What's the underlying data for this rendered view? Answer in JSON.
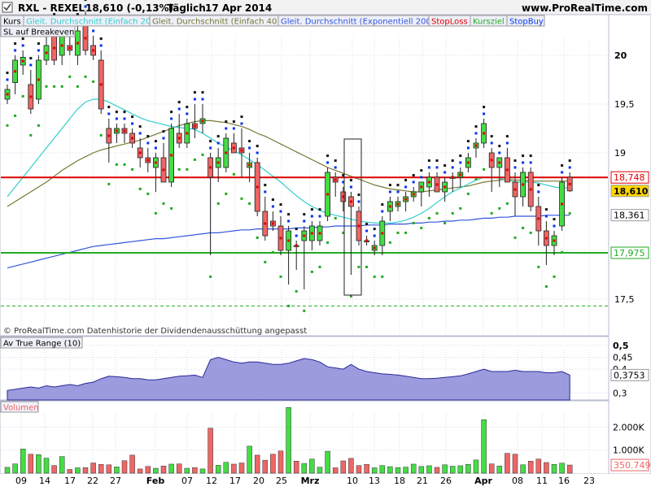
{
  "header": {
    "symbol": "RXL - REXEL",
    "quote": "18,610 (-0,13%)",
    "period": "Täglich",
    "date": "17 Apr 2014",
    "site": "www.ProRealTime.com"
  },
  "legend": {
    "kurs": "Kurs",
    "sma20": "Gleit. Durchschnitt (Einfach 20)",
    "sma40": "Gleit. Durchschnitt (Einfach 40)",
    "ema200": "Gleit. Durchschnitt (Exponentiell 200)",
    "stoploss": "StopLoss",
    "kursziel": "Kursziel",
    "stopbuy": "StopBuy",
    "breakeven": "SL auf Breakeven"
  },
  "footer_note": "© ProRealTime.com  Datenhistorie der Dividendenausschüttung angepasst",
  "atr_label": "Av True Range (10)",
  "volume_label": "Volumen",
  "colors": {
    "up": "#44dd44",
    "down": "#ee6666",
    "sma20": "#33cccc",
    "sma40": "#777733",
    "ema200": "#3355dd",
    "stoploss": "#dd0000",
    "kursziel": "#22aa22",
    "stopbuy": "#0033ee",
    "atr_fill": "#8a8ad8"
  },
  "chart_data": [
    {
      "type": "candlestick",
      "name": "Kurs",
      "y_ticks": [
        "20",
        "19,5",
        "19",
        "18",
        "17,5"
      ],
      "ylim": [
        17.3,
        20.5
      ],
      "x_ticks": [
        "09",
        "14",
        "17",
        "22",
        "27",
        "Feb",
        "07",
        "12",
        "17",
        "20",
        "25",
        "Mrz",
        "10",
        "13",
        "18",
        "21",
        "26",
        "Apr",
        "08",
        "11",
        "16",
        "23"
      ],
      "candles": [
        {
          "o": 19.55,
          "h": 19.7,
          "l": 19.5,
          "c": 19.65
        },
        {
          "o": 19.72,
          "h": 20.0,
          "l": 19.6,
          "c": 19.95
        },
        {
          "o": 19.9,
          "h": 20.05,
          "l": 19.8,
          "c": 19.98
        },
        {
          "o": 19.7,
          "h": 19.85,
          "l": 19.4,
          "c": 19.45
        },
        {
          "o": 19.55,
          "h": 20.0,
          "l": 19.5,
          "c": 19.95
        },
        {
          "o": 19.95,
          "h": 20.25,
          "l": 19.9,
          "c": 20.1
        },
        {
          "o": 20.2,
          "h": 20.3,
          "l": 19.9,
          "c": 19.95
        },
        {
          "o": 20.0,
          "h": 20.25,
          "l": 19.9,
          "c": 20.2
        },
        {
          "o": 20.1,
          "h": 20.25,
          "l": 20.0,
          "c": 20.05
        },
        {
          "o": 20.0,
          "h": 20.3,
          "l": 19.9,
          "c": 20.25
        },
        {
          "o": 20.3,
          "h": 20.45,
          "l": 20.0,
          "c": 20.05
        },
        {
          "o": 20.1,
          "h": 20.2,
          "l": 19.95,
          "c": 20.0
        },
        {
          "o": 19.95,
          "h": 20.05,
          "l": 19.4,
          "c": 19.45
        },
        {
          "o": 19.25,
          "h": 19.35,
          "l": 18.9,
          "c": 19.1
        },
        {
          "o": 19.2,
          "h": 19.3,
          "l": 19.1,
          "c": 19.25
        },
        {
          "o": 19.25,
          "h": 19.3,
          "l": 19.1,
          "c": 19.2
        },
        {
          "o": 19.2,
          "h": 19.25,
          "l": 19.05,
          "c": 19.1
        },
        {
          "o": 19.05,
          "h": 19.15,
          "l": 18.85,
          "c": 18.95
        },
        {
          "o": 18.95,
          "h": 19.05,
          "l": 18.8,
          "c": 18.9
        },
        {
          "o": 18.85,
          "h": 19.0,
          "l": 18.6,
          "c": 18.95
        },
        {
          "o": 18.95,
          "h": 19.1,
          "l": 18.7,
          "c": 18.7
        },
        {
          "o": 18.7,
          "h": 19.3,
          "l": 18.65,
          "c": 19.25
        },
        {
          "o": 19.2,
          "h": 19.4,
          "l": 19.05,
          "c": 19.1
        },
        {
          "o": 19.1,
          "h": 19.35,
          "l": 19.05,
          "c": 19.3
        },
        {
          "o": 19.3,
          "h": 19.5,
          "l": 19.15,
          "c": 19.25
        },
        {
          "o": 19.3,
          "h": 19.5,
          "l": 19.2,
          "c": 19.35
        },
        {
          "o": 18.95,
          "h": 19.0,
          "l": 17.95,
          "c": 18.75
        },
        {
          "o": 18.85,
          "h": 19.05,
          "l": 18.7,
          "c": 18.95
        },
        {
          "o": 18.85,
          "h": 19.2,
          "l": 18.8,
          "c": 19.15
        },
        {
          "o": 19.1,
          "h": 19.2,
          "l": 19.0,
          "c": 19.0
        },
        {
          "o": 19.05,
          "h": 19.25,
          "l": 18.75,
          "c": 19.0
        },
        {
          "o": 18.85,
          "h": 19.0,
          "l": 18.7,
          "c": 18.9
        },
        {
          "o": 18.9,
          "h": 18.95,
          "l": 18.35,
          "c": 18.4
        },
        {
          "o": 18.4,
          "h": 18.55,
          "l": 18.1,
          "c": 18.15
        },
        {
          "o": 18.3,
          "h": 18.4,
          "l": 18.2,
          "c": 18.25
        },
        {
          "o": 18.25,
          "h": 18.35,
          "l": 17.95,
          "c": 18.0
        },
        {
          "o": 18.0,
          "h": 18.25,
          "l": 17.65,
          "c": 18.2
        },
        {
          "o": 18.05,
          "h": 18.1,
          "l": 17.8,
          "c": 18.05
        },
        {
          "o": 18.1,
          "h": 18.25,
          "l": 17.6,
          "c": 18.2
        },
        {
          "o": 18.1,
          "h": 18.3,
          "l": 18.0,
          "c": 18.25
        },
        {
          "o": 18.1,
          "h": 18.3,
          "l": 18.05,
          "c": 18.25
        },
        {
          "o": 18.35,
          "h": 18.85,
          "l": 18.3,
          "c": 18.8
        },
        {
          "o": 18.75,
          "h": 18.8,
          "l": 18.55,
          "c": 18.7
        },
        {
          "o": 18.6,
          "h": 18.65,
          "l": 18.4,
          "c": 18.5
        },
        {
          "o": 18.55,
          "h": 18.6,
          "l": 17.75,
          "c": 18.45
        },
        {
          "o": 18.4,
          "h": 18.45,
          "l": 18.05,
          "c": 18.1
        },
        {
          "o": 18.1,
          "h": 18.15,
          "l": 18.05,
          "c": 18.1
        },
        {
          "o": 18.0,
          "h": 18.1,
          "l": 17.95,
          "c": 18.05
        },
        {
          "o": 18.05,
          "h": 18.35,
          "l": 17.95,
          "c": 18.3
        },
        {
          "o": 18.4,
          "h": 18.55,
          "l": 18.3,
          "c": 18.5
        },
        {
          "o": 18.45,
          "h": 18.55,
          "l": 18.4,
          "c": 18.5
        },
        {
          "o": 18.5,
          "h": 18.6,
          "l": 18.4,
          "c": 18.55
        },
        {
          "o": 18.55,
          "h": 18.65,
          "l": 18.5,
          "c": 18.6
        },
        {
          "o": 18.6,
          "h": 18.7,
          "l": 18.45,
          "c": 18.7
        },
        {
          "o": 18.65,
          "h": 18.8,
          "l": 18.55,
          "c": 18.75
        },
        {
          "o": 18.75,
          "h": 18.8,
          "l": 18.6,
          "c": 18.6
        },
        {
          "o": 18.6,
          "h": 18.75,
          "l": 18.5,
          "c": 18.7
        },
        {
          "o": 18.75,
          "h": 18.8,
          "l": 18.6,
          "c": 18.75
        },
        {
          "o": 18.75,
          "h": 18.85,
          "l": 18.65,
          "c": 18.8
        },
        {
          "o": 18.85,
          "h": 19.0,
          "l": 18.8,
          "c": 18.95
        },
        {
          "o": 19.05,
          "h": 19.15,
          "l": 18.95,
          "c": 19.1
        },
        {
          "o": 19.1,
          "h": 19.35,
          "l": 19.05,
          "c": 19.3
        },
        {
          "o": 19.0,
          "h": 19.05,
          "l": 18.6,
          "c": 18.85
        },
        {
          "o": 18.85,
          "h": 18.95,
          "l": 18.65,
          "c": 18.95
        },
        {
          "o": 18.95,
          "h": 19.05,
          "l": 18.7,
          "c": 18.7
        },
        {
          "o": 18.7,
          "h": 18.8,
          "l": 18.35,
          "c": 18.55
        },
        {
          "o": 18.55,
          "h": 18.85,
          "l": 18.45,
          "c": 18.8
        },
        {
          "o": 18.8,
          "h": 18.85,
          "l": 18.4,
          "c": 18.45
        },
        {
          "o": 18.45,
          "h": 18.55,
          "l": 18.05,
          "c": 18.2
        },
        {
          "o": 18.2,
          "h": 18.3,
          "l": 17.85,
          "c": 18.05
        },
        {
          "o": 18.05,
          "h": 18.2,
          "l": 17.95,
          "c": 18.15
        },
        {
          "o": 18.25,
          "h": 18.75,
          "l": 18.2,
          "c": 18.7
        },
        {
          "o": 18.75,
          "h": 18.8,
          "l": 18.6,
          "c": 18.61
        }
      ],
      "sma20": [
        18.55,
        18.65,
        18.75,
        18.85,
        18.95,
        19.05,
        19.15,
        19.25,
        19.35,
        19.45,
        19.52,
        19.55,
        19.55,
        19.52,
        19.48,
        19.44,
        19.4,
        19.36,
        19.33,
        19.31,
        19.29,
        19.27,
        19.26,
        19.25,
        19.24,
        19.2,
        19.15,
        19.1,
        19.06,
        19.02,
        18.98,
        18.93,
        18.88,
        18.82,
        18.76,
        18.7,
        18.63,
        18.56,
        18.5,
        18.45,
        18.41,
        18.38,
        18.36,
        18.34,
        18.32,
        18.3,
        18.29,
        18.28,
        18.28,
        18.28,
        18.29,
        18.31,
        18.34,
        18.38,
        18.43,
        18.49,
        18.55,
        18.6,
        18.64,
        18.68,
        18.72,
        18.75,
        18.75,
        18.74,
        18.72,
        18.7,
        18.7,
        18.7,
        18.69,
        18.67,
        18.65,
        18.64,
        18.64
      ],
      "sma40": [
        18.45,
        18.5,
        18.55,
        18.6,
        18.65,
        18.7,
        18.76,
        18.82,
        18.87,
        18.92,
        18.96,
        19.0,
        19.03,
        19.05,
        19.07,
        19.09,
        19.11,
        19.13,
        19.16,
        19.19,
        19.22,
        19.25,
        19.28,
        19.3,
        19.32,
        19.33,
        19.33,
        19.32,
        19.31,
        19.29,
        19.27,
        19.24,
        19.2,
        19.17,
        19.13,
        19.09,
        19.05,
        19.01,
        18.97,
        18.93,
        18.89,
        18.85,
        18.82,
        18.79,
        18.76,
        18.73,
        18.7,
        18.67,
        18.65,
        18.63,
        18.62,
        18.61,
        18.6,
        18.6,
        18.61,
        18.62,
        18.63,
        18.64,
        18.65,
        18.66,
        18.68,
        18.7,
        18.71,
        18.72,
        18.73,
        18.72,
        18.72,
        18.71,
        18.71,
        18.71,
        18.71,
        18.71,
        18.71
      ],
      "ema200": [
        17.82,
        17.84,
        17.86,
        17.88,
        17.9,
        17.92,
        17.94,
        17.96,
        17.98,
        18.0,
        18.02,
        18.04,
        18.05,
        18.06,
        18.07,
        18.08,
        18.09,
        18.1,
        18.11,
        18.12,
        18.12,
        18.13,
        18.14,
        18.15,
        18.16,
        18.17,
        18.18,
        18.18,
        18.19,
        18.2,
        18.21,
        18.21,
        18.22,
        18.22,
        18.22,
        18.22,
        18.22,
        18.23,
        18.23,
        18.23,
        18.24,
        18.24,
        18.25,
        18.25,
        18.25,
        18.25,
        18.26,
        18.26,
        18.26,
        18.27,
        18.27,
        18.27,
        18.28,
        18.28,
        18.29,
        18.29,
        18.3,
        18.3,
        18.31,
        18.31,
        18.32,
        18.33,
        18.33,
        18.34,
        18.34,
        18.35,
        18.35,
        18.35,
        18.35,
        18.36,
        18.36,
        18.36,
        18.36
      ],
      "stoploss": 18.748,
      "kursziel": 17.975,
      "breakeven_dashed": 17.43,
      "value_labels": [
        {
          "text": "18,748",
          "value": 18.748,
          "style": "stoploss"
        },
        {
          "text": "18,610",
          "value": 18.61,
          "style": "current"
        },
        {
          "text": "18,361",
          "value": 18.361,
          "style": "ema"
        },
        {
          "text": "17,975",
          "value": 17.975,
          "style": "kursziel"
        }
      ]
    },
    {
      "type": "area",
      "name": "Av True Range (10)",
      "y_ticks": [
        "0,5",
        "0,45",
        "0,4",
        "0,3"
      ],
      "ylim": [
        0.27,
        0.51
      ],
      "values": [
        0.31,
        0.315,
        0.32,
        0.325,
        0.32,
        0.33,
        0.325,
        0.33,
        0.335,
        0.33,
        0.34,
        0.345,
        0.36,
        0.37,
        0.368,
        0.365,
        0.36,
        0.36,
        0.355,
        0.355,
        0.36,
        0.365,
        0.37,
        0.372,
        0.375,
        0.365,
        0.44,
        0.45,
        0.44,
        0.43,
        0.425,
        0.43,
        0.43,
        0.425,
        0.42,
        0.42,
        0.425,
        0.435,
        0.445,
        0.44,
        0.43,
        0.41,
        0.405,
        0.4,
        0.42,
        0.4,
        0.39,
        0.385,
        0.38,
        0.378,
        0.375,
        0.37,
        0.365,
        0.36,
        0.36,
        0.362,
        0.365,
        0.368,
        0.372,
        0.38,
        0.39,
        0.4,
        0.39,
        0.39,
        0.39,
        0.395,
        0.39,
        0.39,
        0.39,
        0.385,
        0.385,
        0.39,
        0.375
      ],
      "value_label": "0,3753"
    },
    {
      "type": "bar",
      "name": "Volumen",
      "y_ticks": [
        "2.000K",
        "1.000K"
      ],
      "ylim": [
        0,
        3000
      ],
      "values": [
        250,
        400,
        1050,
        820,
        800,
        650,
        330,
        720,
        160,
        230,
        240,
        440,
        380,
        360,
        270,
        540,
        780,
        180,
        290,
        210,
        310,
        390,
        400,
        210,
        240,
        180,
        1950,
        340,
        470,
        390,
        440,
        1170,
        780,
        560,
        820,
        960,
        2850,
        520,
        420,
        610,
        260,
        950,
        230,
        530,
        640,
        330,
        380,
        230,
        330,
        280,
        240,
        260,
        390,
        290,
        320,
        250,
        360,
        300,
        320,
        380,
        570,
        2320,
        400,
        310,
        860,
        820,
        360,
        520,
        610,
        460,
        380,
        430,
        351
      ],
      "up": [
        1,
        1,
        1,
        0,
        1,
        1,
        0,
        1,
        0,
        1,
        0,
        0,
        0,
        0,
        1,
        0,
        0,
        0,
        0,
        1,
        0,
        1,
        0,
        1,
        0,
        1,
        0,
        1,
        1,
        0,
        0,
        1,
        0,
        0,
        0,
        0,
        1,
        0,
        1,
        1,
        1,
        1,
        0,
        0,
        0,
        0,
        0,
        1,
        1,
        1,
        1,
        1,
        1,
        1,
        1,
        0,
        1,
        1,
        1,
        1,
        1,
        1,
        0,
        1,
        0,
        0,
        1,
        0,
        0,
        0,
        1,
        1,
        0
      ],
      "value_label": "350.749"
    }
  ]
}
